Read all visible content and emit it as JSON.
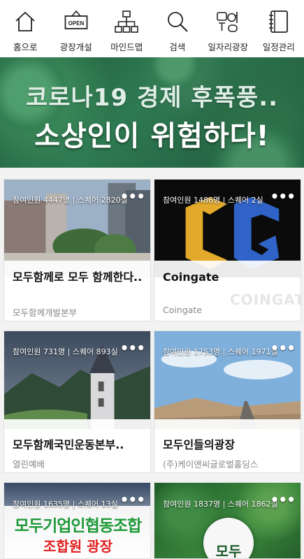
{
  "nav": [
    {
      "label": "홈으로",
      "icon": "home-icon"
    },
    {
      "label": "광장개설",
      "icon": "open-sign-icon",
      "icon_text": "OPEN"
    },
    {
      "label": "마인드맵",
      "icon": "mindmap-icon"
    },
    {
      "label": "검색",
      "icon": "search-icon"
    },
    {
      "label": "일자리광장",
      "icon": "job-plaza-icon"
    },
    {
      "label": "일정관리",
      "icon": "planner-icon"
    }
  ],
  "banner": {
    "line1": "코로나19 경제 후폭풍..",
    "line2": "소상인이 위험하다!"
  },
  "cards": [
    {
      "stats": "참여인원 4447명 | 스퀘어 2820실",
      "title": "모두함께로 모두 함께한다..",
      "sub": "모두함께개발본부",
      "image": "city-plaza"
    },
    {
      "stats": "참여인원 1486명 | 스퀘어 2실",
      "title": "Coingate",
      "sub": "Coingate",
      "image": "coingate-logo",
      "logo_text": "COINGATE"
    },
    {
      "stats": "참여인원 731명 | 스퀘어 893실",
      "title": "모두함께국민운동본부..",
      "sub": "열린예배",
      "image": "church-tower"
    },
    {
      "stats": "참여인원 1753명 | 스퀘어 1971실",
      "title": "모두인들의광장",
      "sub": "(주)케이앤씨글로벌홀딩스",
      "image": "desert-road"
    },
    {
      "stats": "참여인원 1635명 | 스퀘어 13실",
      "title": "",
      "sub": "",
      "image": "union-banner",
      "image_text_1": "모두기업인협동조합",
      "image_text_2": "조합원 광장"
    },
    {
      "stats": "참여인원 1837명 | 스퀘어 1862실",
      "title": "",
      "sub": "",
      "image": "green-leaves",
      "image_text_1": "모두"
    }
  ],
  "colors": {
    "banner_green": "#2e7a52",
    "coingate_yellow": "#e3a92a",
    "coingate_blue": "#2f63c8",
    "union_green": "#1f9a3a",
    "union_red": "#e02020"
  }
}
